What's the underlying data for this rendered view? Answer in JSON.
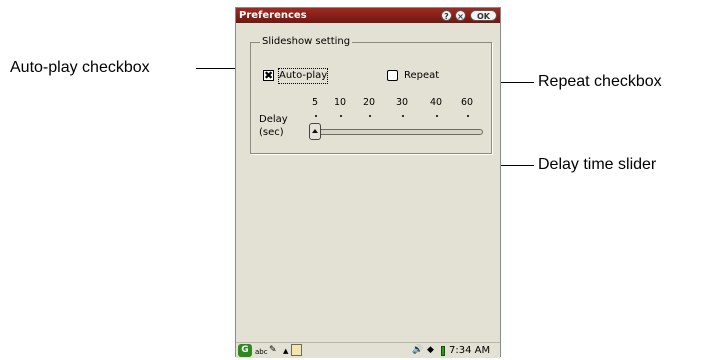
{
  "window": {
    "title": "Preferences",
    "help_icon": "question-icon",
    "close_icon": "close-icon",
    "ok_label": "OK"
  },
  "group": {
    "title": "Slideshow setting",
    "autoplay": {
      "label": "Auto-play",
      "checked": true,
      "mark": "✖"
    },
    "repeat": {
      "label": "Repeat",
      "checked": false
    },
    "delay": {
      "label_line1": "Delay",
      "label_line2": "(sec)",
      "ticks": [
        "5",
        "10",
        "20",
        "30",
        "40",
        "60"
      ],
      "value": "5"
    }
  },
  "statusbar": {
    "logo_icon": "app-launcher-icon",
    "input_mode": "abc",
    "pen_icon": "pen-icon",
    "clock": "7:34 AM",
    "speaker_icon": "speaker-icon",
    "battery_icon": "battery-icon"
  },
  "annotations": {
    "autoplay": "Auto-play checkbox",
    "repeat": "Repeat checkbox",
    "delay": "Delay time slider"
  }
}
